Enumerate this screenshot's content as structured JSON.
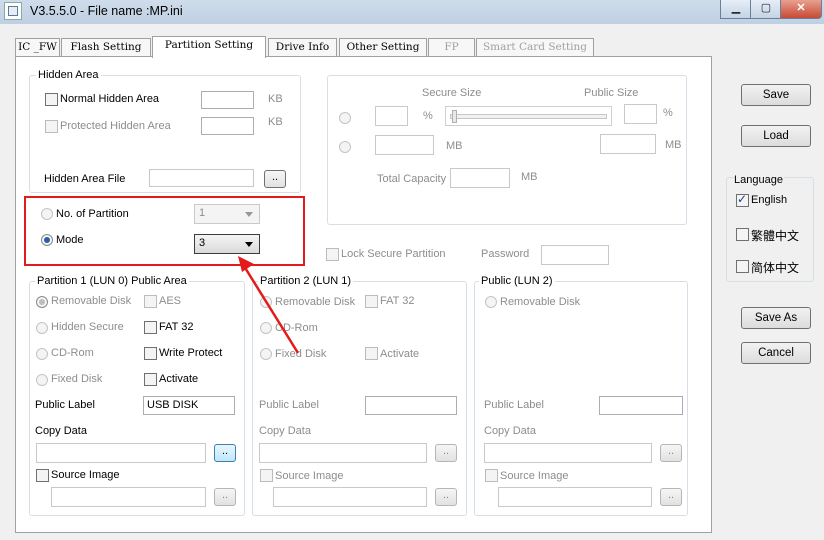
{
  "window": {
    "title": "V3.5.5.0 - File name :MP.ini"
  },
  "tabs": [
    "IC _FW",
    "Flash Setting",
    "Partition Setting",
    "Drive Info",
    "Other Setting",
    "FP",
    "Smart Card Setting"
  ],
  "hidden_area": {
    "title": "Hidden Area",
    "normal_label": "Normal Hidden Area",
    "protected_label": "Protected Hidden Area",
    "kb1": "KB",
    "kb2": "KB",
    "file_label": "Hidden Area File",
    "browse": ".."
  },
  "secure": {
    "secure_size_label": "Secure Size",
    "public_size_label": "Public Size",
    "percent1": "%",
    "percent2": "%",
    "mb1": "MB",
    "mb2": "MB",
    "total_capacity_label": "Total Capacity",
    "mb3": "MB",
    "lock_label": "Lock Secure Partition",
    "password_label": "Password"
  },
  "partition_mode": {
    "no_of_partition_label": "No. of Partition",
    "no_of_partition_value": "1",
    "mode_label": "Mode",
    "mode_value": "3"
  },
  "partition1": {
    "title": "Partition 1 (LUN 0) Public Area",
    "removable": "Removable Disk",
    "aes": "AES",
    "hidden_secure": "Hidden Secure",
    "fat32": "FAT 32",
    "cdrom": "CD-Rom",
    "write_protect": "Write Protect",
    "fixed": "Fixed Disk",
    "activate": "Activate",
    "public_label": "Public Label",
    "public_label_value": "USB DISK",
    "copy_data": "Copy Data",
    "source_image": "Source Image",
    "browse1": "..",
    "browse2": ".."
  },
  "partition2": {
    "title": "Partition 2 (LUN 1)",
    "removable": "Removable Disk",
    "fat32": "FAT 32",
    "cdrom": "CD-Rom",
    "fixed": "Fixed Disk",
    "activate": "Activate",
    "public_label": "Public Label",
    "copy_data": "Copy Data",
    "source_image": "Source Image",
    "browse1": "..",
    "browse2": ".."
  },
  "public_lun2": {
    "title": "Public (LUN 2)",
    "removable": "Removable Disk",
    "public_label": "Public Label",
    "copy_data": "Copy Data",
    "source_image": "Source Image",
    "browse1": "..",
    "browse2": ".."
  },
  "side": {
    "save": "Save",
    "load": "Load",
    "language_title": "Language",
    "english": "English",
    "trad_chinese": "繁體中文",
    "simp_chinese": "简体中文",
    "save_as": "Save As",
    "cancel": "Cancel"
  },
  "colors": {
    "highlight_red": "#e31b1b",
    "titlebar": "#c8d8ea",
    "close_button": "#c74a33"
  }
}
